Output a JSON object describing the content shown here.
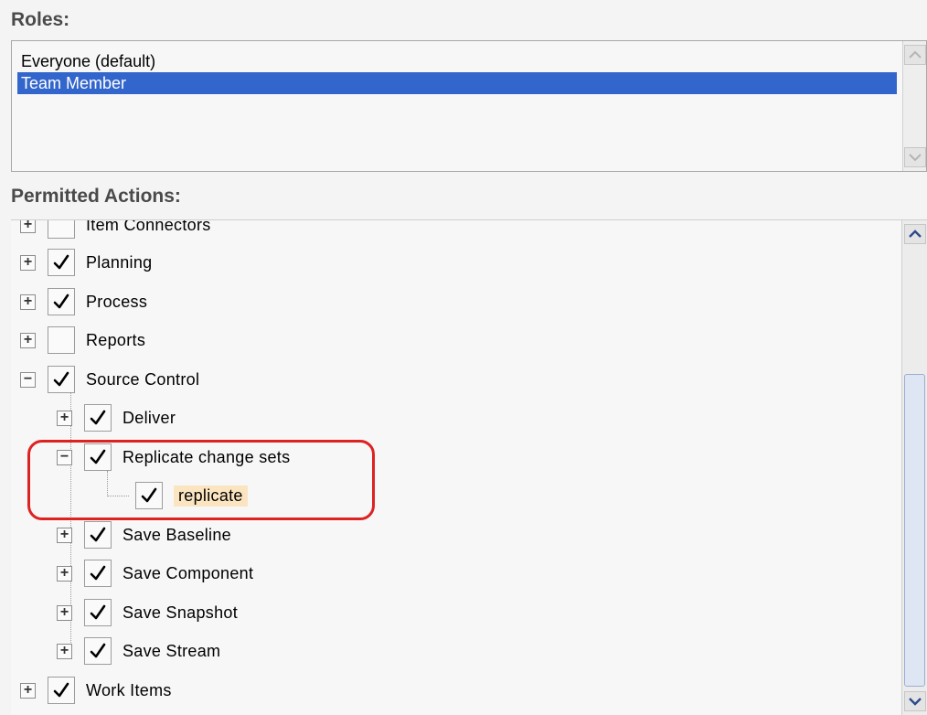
{
  "roles": {
    "label": "Roles:",
    "items": [
      {
        "label": "Everyone (default)",
        "selected": false
      },
      {
        "label": "Team Member",
        "selected": true
      }
    ]
  },
  "permitted_actions": {
    "label": "Permitted Actions:",
    "tree": [
      {
        "label": "Item Connectors",
        "expander": "+",
        "checked": false,
        "depth": 0
      },
      {
        "label": "Planning",
        "expander": "+",
        "checked": true,
        "depth": 0
      },
      {
        "label": "Process",
        "expander": "+",
        "checked": true,
        "depth": 0
      },
      {
        "label": "Reports",
        "expander": "+",
        "checked": false,
        "depth": 0
      },
      {
        "label": "Source Control",
        "expander": "−",
        "checked": true,
        "depth": 0
      },
      {
        "label": "Deliver",
        "expander": "+",
        "checked": true,
        "depth": 1
      },
      {
        "label": "Replicate change sets",
        "expander": "−",
        "checked": true,
        "depth": 1
      },
      {
        "label": "replicate",
        "expander": "",
        "checked": true,
        "depth": 2,
        "highlighted": true
      },
      {
        "label": "Save Baseline",
        "expander": "+",
        "checked": true,
        "depth": 1
      },
      {
        "label": "Save Component",
        "expander": "+",
        "checked": true,
        "depth": 1
      },
      {
        "label": "Save Snapshot",
        "expander": "+",
        "checked": true,
        "depth": 1
      },
      {
        "label": "Save Stream",
        "expander": "+",
        "checked": true,
        "depth": 1
      },
      {
        "label": "Work Items",
        "expander": "+",
        "checked": true,
        "depth": 0
      }
    ]
  },
  "colors": {
    "selection": "#3366cc",
    "highlight_ring": "#dd2222",
    "item_highlight": "#fbe5c0"
  }
}
